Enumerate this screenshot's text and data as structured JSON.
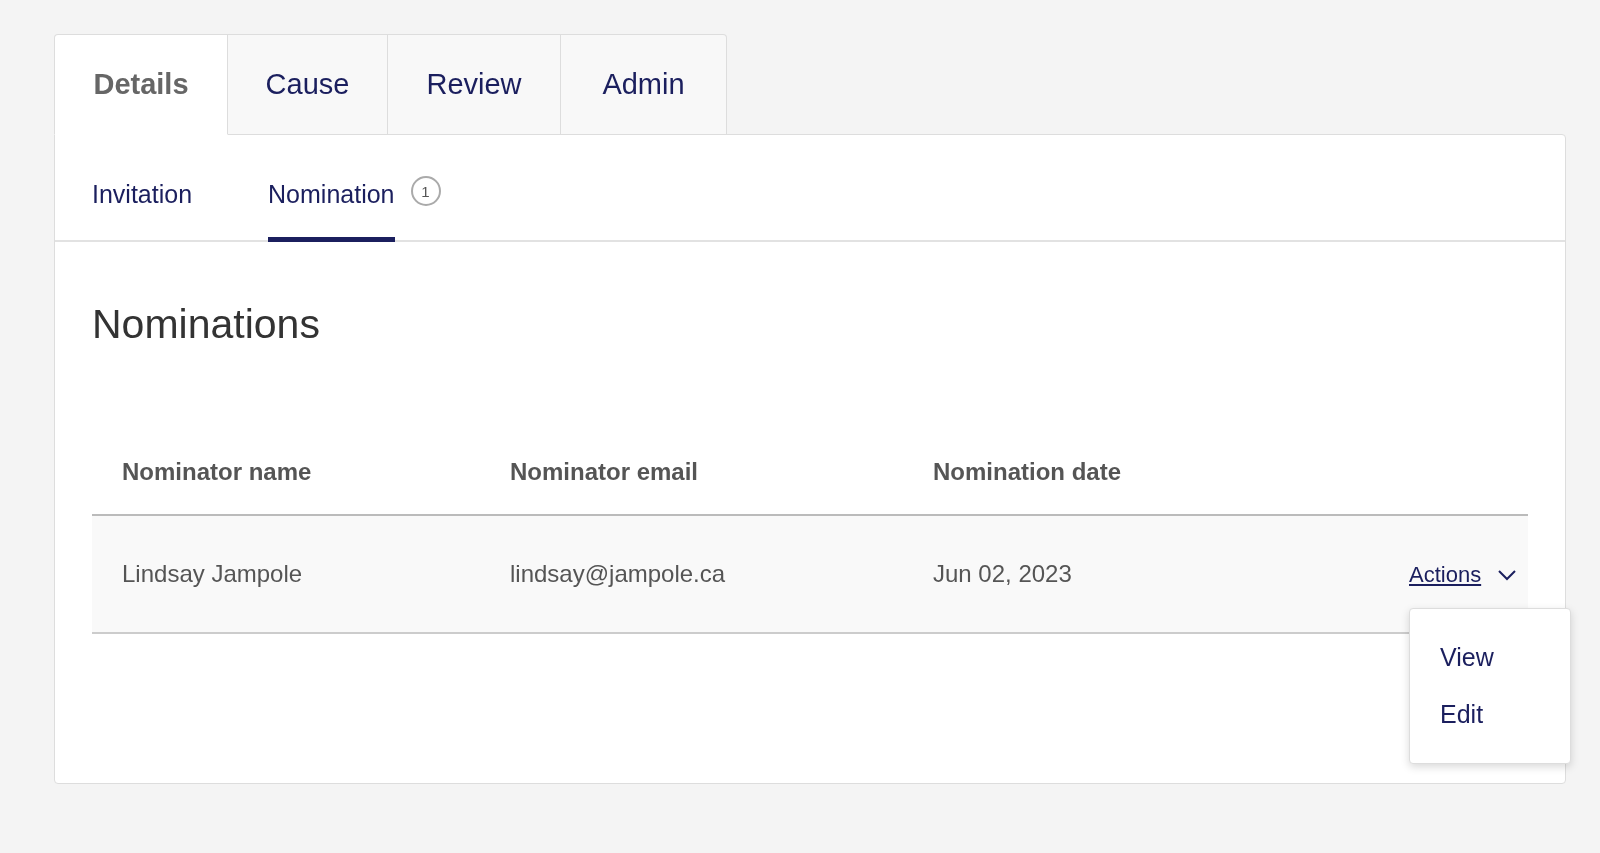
{
  "tabs": [
    {
      "label": "Details",
      "selected": true
    },
    {
      "label": "Cause",
      "selected": false
    },
    {
      "label": "Review",
      "selected": false
    },
    {
      "label": "Admin",
      "selected": false
    }
  ],
  "subtabs": [
    {
      "label": "Invitation",
      "selected": false
    },
    {
      "label": "Nomination",
      "selected": true,
      "badge": "1"
    }
  ],
  "heading": "Nominations",
  "table": {
    "columns": [
      "Nominator name",
      "Nominator email",
      "Nomination date"
    ],
    "rows": [
      {
        "cells": [
          "Lindsay Jampole",
          "lindsay@jampole.ca",
          "Jun 02, 2023"
        ],
        "actions": "Actions",
        "menu_open": true
      }
    ]
  },
  "actions_menu": {
    "items": [
      "View",
      "Edit"
    ]
  }
}
